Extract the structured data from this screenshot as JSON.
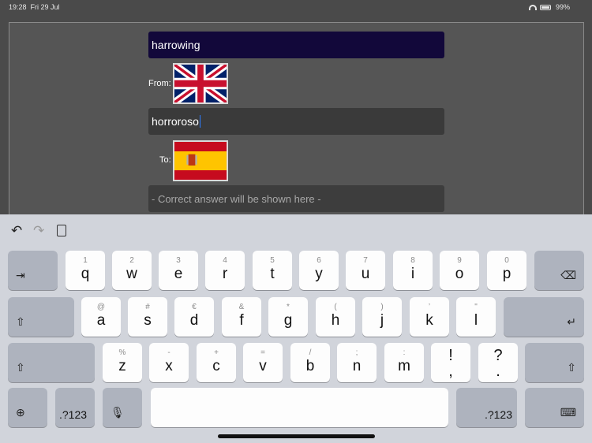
{
  "status": {
    "time": "19:28",
    "date": "Fri 29 Jul",
    "battery": "99%"
  },
  "form": {
    "source_text": "harrowing",
    "from_label": "From:",
    "target_text": "horroroso",
    "to_label": "To:",
    "answer_placeholder": "- Correct answer will be shown here -"
  },
  "flags": {
    "source": "uk-flag-icon",
    "target": "spain-flag-icon"
  },
  "keyboard": {
    "row1": [
      {
        "k": "q",
        "a": "1"
      },
      {
        "k": "w",
        "a": "2"
      },
      {
        "k": "e",
        "a": "3"
      },
      {
        "k": "r",
        "a": "4"
      },
      {
        "k": "t",
        "a": "5"
      },
      {
        "k": "y",
        "a": "6"
      },
      {
        "k": "u",
        "a": "7"
      },
      {
        "k": "i",
        "a": "8"
      },
      {
        "k": "o",
        "a": "9"
      },
      {
        "k": "p",
        "a": "0"
      }
    ],
    "row2": [
      {
        "k": "a",
        "a": "@"
      },
      {
        "k": "s",
        "a": "#"
      },
      {
        "k": "d",
        "a": "€"
      },
      {
        "k": "f",
        "a": "&"
      },
      {
        "k": "g",
        "a": "*"
      },
      {
        "k": "h",
        "a": "("
      },
      {
        "k": "j",
        "a": ")"
      },
      {
        "k": "k",
        "a": "’"
      },
      {
        "k": "l",
        "a": "\""
      }
    ],
    "row3": [
      {
        "k": "z",
        "a": "%"
      },
      {
        "k": "x",
        "a": "-"
      },
      {
        "k": "c",
        "a": "+"
      },
      {
        "k": "v",
        "a": "="
      },
      {
        "k": "b",
        "a": "/"
      },
      {
        "k": "n",
        "a": ";"
      },
      {
        "k": "m",
        "a": ":"
      }
    ],
    "punct": [
      {
        "top": "!",
        "bottom": ","
      },
      {
        "top": "?",
        "bottom": "."
      }
    ],
    "numbers_label": ".?123",
    "tab_symbol": "⇥",
    "delete_symbol": "⌫",
    "return_symbol": "↵",
    "shift_symbol": "⇧",
    "globe_symbol": "⊕",
    "mic_symbol": "🎙",
    "hide_keyboard_symbol": "⌨",
    "undo_symbol": "↶",
    "redo_symbol": "↷"
  }
}
